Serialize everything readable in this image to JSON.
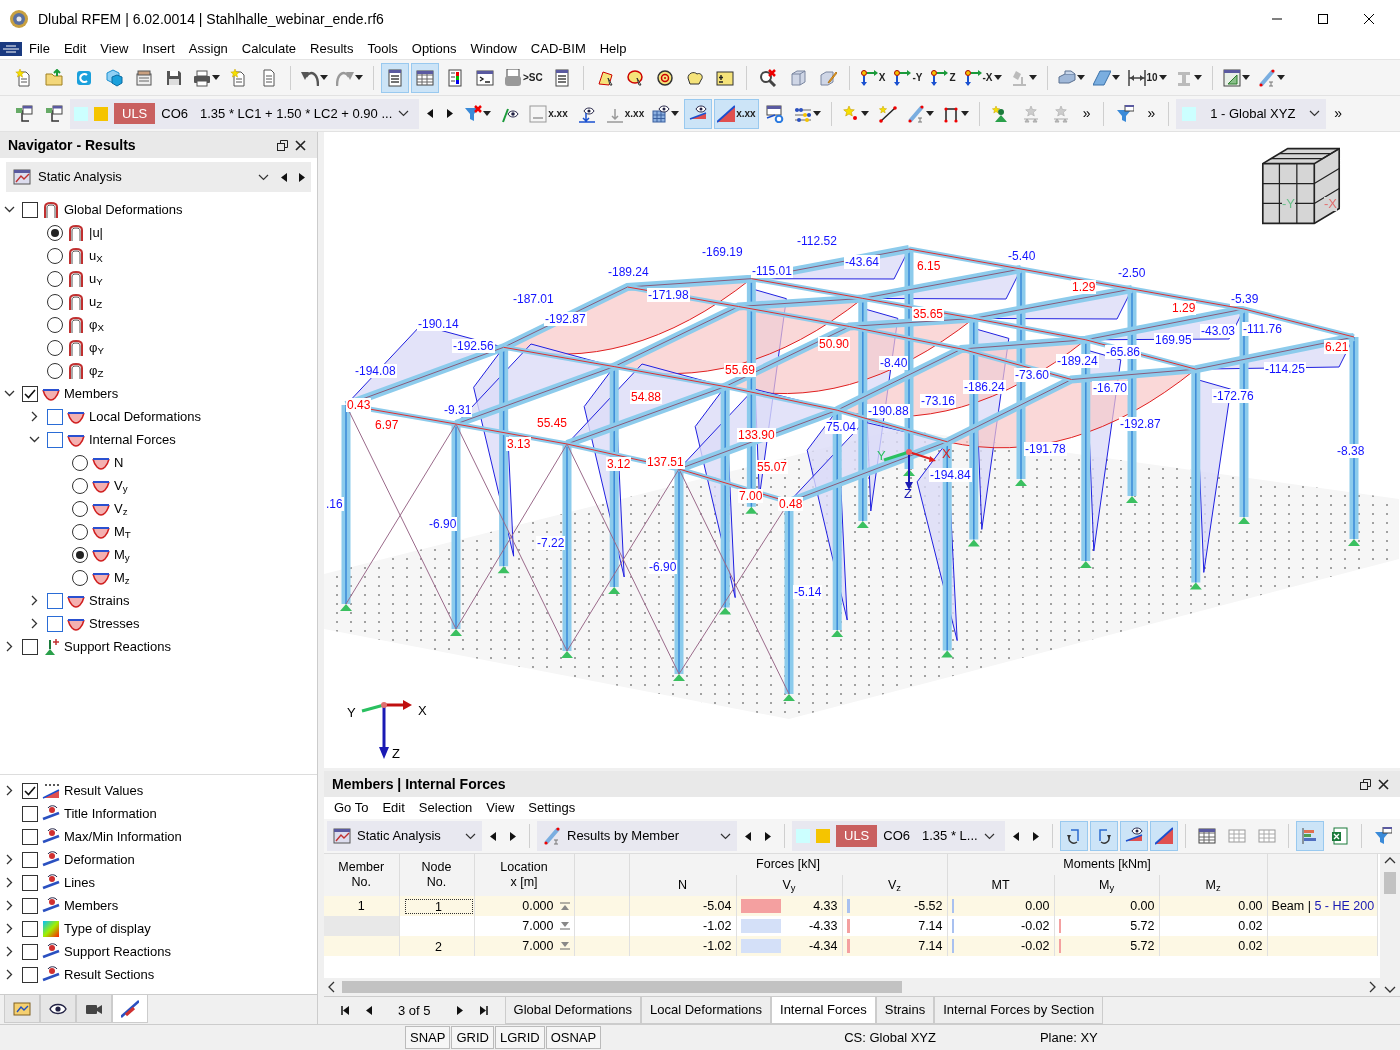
{
  "window": {
    "title": "Dlubal RFEM | 6.02.0014 | Stahlhalle_webinar_ende.rf6"
  },
  "menu": [
    "File",
    "Edit",
    "View",
    "Insert",
    "Assign",
    "Calculate",
    "Results",
    "Tools",
    "Options",
    "Window",
    "CAD-BIM",
    "Help"
  ],
  "toolbar_1": [
    {
      "kind": "button",
      "dropdown": false,
      "selected": false
    },
    {
      "kind": "button",
      "dropdown": false,
      "selected": false
    },
    {
      "kind": "button",
      "dropdown": false,
      "selected": false
    },
    {
      "kind": "button",
      "dropdown": false,
      "selected": false
    },
    {
      "kind": "button",
      "dropdown": false,
      "selected": false
    },
    {
      "kind": "button",
      "dropdown": false,
      "selected": false
    },
    {
      "kind": "button",
      "dropdown": true,
      "selected": false
    },
    {
      "kind": "button",
      "dropdown": false,
      "selected": false
    },
    {
      "kind": "button",
      "dropdown": false,
      "selected": false
    },
    {
      "kind": "separator"
    },
    {
      "kind": "button",
      "dropdown": true,
      "selected": false
    },
    {
      "kind": "button",
      "dropdown": true,
      "selected": false
    },
    {
      "kind": "separator"
    },
    {
      "kind": "button",
      "dropdown": false,
      "selected": true
    },
    {
      "kind": "button",
      "dropdown": false,
      "selected": true
    },
    {
      "kind": "button",
      "dropdown": false,
      "selected": false
    },
    {
      "kind": "button",
      "dropdown": false,
      "selected": false
    },
    {
      "kind": "button",
      "dropdown": false,
      "selected": false,
      "text": ">SC"
    },
    {
      "kind": "button",
      "dropdown": false,
      "selected": false
    },
    {
      "kind": "separator"
    },
    {
      "kind": "button",
      "dropdown": false,
      "selected": false
    },
    {
      "kind": "button",
      "dropdown": false,
      "selected": false
    },
    {
      "kind": "button",
      "dropdown": false,
      "selected": false
    },
    {
      "kind": "button",
      "dropdown": false,
      "selected": false
    },
    {
      "kind": "button",
      "dropdown": false,
      "selected": false
    },
    {
      "kind": "separator"
    },
    {
      "kind": "button",
      "dropdown": false,
      "selected": false
    },
    {
      "kind": "button",
      "dropdown": false,
      "selected": false
    },
    {
      "kind": "button",
      "dropdown": false,
      "selected": false
    },
    {
      "kind": "separator"
    },
    {
      "kind": "button",
      "dropdown": false,
      "selected": false,
      "text": "X"
    },
    {
      "kind": "button",
      "dropdown": false,
      "selected": false,
      "text": "-Y"
    },
    {
      "kind": "button",
      "dropdown": false,
      "selected": false,
      "text": "Z"
    },
    {
      "kind": "button",
      "dropdown": true,
      "selected": false,
      "text": "-X"
    },
    {
      "kind": "button",
      "dropdown": true,
      "selected": false
    },
    {
      "kind": "separator"
    },
    {
      "kind": "button",
      "dropdown": true,
      "selected": false
    },
    {
      "kind": "button",
      "dropdown": true,
      "selected": false
    },
    {
      "kind": "button",
      "dropdown": true,
      "selected": false,
      "text": "10"
    },
    {
      "kind": "button",
      "dropdown": true,
      "selected": false
    },
    {
      "kind": "separator"
    },
    {
      "kind": "button",
      "dropdown": true,
      "selected": false
    },
    {
      "kind": "button",
      "dropdown": true,
      "selected": false
    }
  ],
  "toolbar_2": [
    {
      "kind": "button",
      "dropdown": false,
      "selected": false
    },
    {
      "kind": "button",
      "dropdown": false,
      "selected": false
    },
    {
      "kind": "loadcase",
      "swatches": [
        {
          "color": "#ccffff"
        },
        {
          "color": "#f5c400"
        }
      ],
      "type": "ULS",
      "name": "CO6",
      "combo": "1.35 * LC1 + 1.50 * LC2 + 0.90 ..."
    },
    {
      "kind": "button",
      "dropdown": true,
      "selected": false
    },
    {
      "kind": "button",
      "dropdown": false,
      "selected": false
    },
    {
      "kind": "button",
      "dropdown": false,
      "selected": false,
      "text": "x.xx"
    },
    {
      "kind": "button",
      "dropdown": false,
      "selected": false
    },
    {
      "kind": "button",
      "dropdown": false,
      "selected": false,
      "text": "x.xx"
    },
    {
      "kind": "button",
      "dropdown": true,
      "selected": false
    },
    {
      "kind": "button",
      "dropdown": false,
      "selected": true
    },
    {
      "kind": "button",
      "dropdown": false,
      "selected": true,
      "text": "x.xx"
    },
    {
      "kind": "button",
      "dropdown": false,
      "selected": false
    },
    {
      "kind": "button",
      "dropdown": true,
      "selected": false
    },
    {
      "kind": "separator"
    },
    {
      "kind": "button",
      "dropdown": true,
      "selected": false
    },
    {
      "kind": "button",
      "dropdown": false,
      "selected": false
    },
    {
      "kind": "button",
      "dropdown": true,
      "selected": false
    },
    {
      "kind": "button",
      "dropdown": true,
      "selected": false
    },
    {
      "kind": "separator"
    },
    {
      "kind": "button",
      "dropdown": false,
      "selected": false
    },
    {
      "kind": "button",
      "dropdown": false,
      "selected": false
    },
    {
      "kind": "button",
      "dropdown": false,
      "selected": false
    },
    {
      "kind": "more",
      "text": "»"
    },
    {
      "kind": "separator"
    },
    {
      "kind": "button",
      "dropdown": false,
      "selected": false
    },
    {
      "kind": "more",
      "text": "»"
    },
    {
      "kind": "separator"
    },
    {
      "kind": "combo",
      "color": "#ccffff",
      "text": "1 - Global XYZ"
    },
    {
      "kind": "more",
      "text": "»"
    }
  ],
  "navigator": {
    "title": "Navigator - Results",
    "analysis": "Static Analysis",
    "tree": [
      {
        "label": "Global Deformations",
        "kind": "deformation",
        "checked": false,
        "expanded": true,
        "children": [
          {
            "label": "|u|",
            "kind": "deformation",
            "selected": true
          },
          {
            "label": "u$_{X}$",
            "kind": "deformation",
            "selected": false
          },
          {
            "label": "u$_{Y}$",
            "kind": "deformation",
            "selected": false
          },
          {
            "label": "u$_{Z}$",
            "kind": "deformation",
            "selected": false
          },
          {
            "label": "φ$_{X}$",
            "kind": "deformation",
            "selected": false
          },
          {
            "label": "φ$_{Y}$",
            "kind": "deformation",
            "selected": false
          },
          {
            "label": "φ$_{Z}$",
            "kind": "deformation",
            "selected": false
          }
        ]
      },
      {
        "label": "Members",
        "kind": "member",
        "checked": true,
        "expanded": true,
        "children": [
          {
            "label": "Local Deformations",
            "kind": "member",
            "checked": false,
            "expanded": false
          },
          {
            "label": "Internal Forces",
            "kind": "member",
            "checked": false,
            "expanded": true,
            "children": [
              {
                "label": "N",
                "kind": "member",
                "selected": false
              },
              {
                "label": "V$_{y}$",
                "kind": "member",
                "selected": false
              },
              {
                "label": "V$_{z}$",
                "kind": "member",
                "selected": false
              },
              {
                "label": "M$_{T}$",
                "kind": "member",
                "selected": false
              },
              {
                "label": "M$_{y}$",
                "kind": "member",
                "selected": true
              },
              {
                "label": "M$_{z}$",
                "kind": "member",
                "selected": false
              }
            ]
          },
          {
            "label": "Strains",
            "kind": "member",
            "checked": false,
            "expanded": false
          },
          {
            "label": "Stresses",
            "kind": "member",
            "checked": false,
            "expanded": false
          }
        ]
      },
      {
        "label": "Support Reactions",
        "kind": "support",
        "checked": false,
        "expanded": false
      }
    ],
    "display_tree": [
      {
        "label": "Result Values",
        "kind": "values",
        "checked": true,
        "expanded": false
      },
      {
        "label": "Title Information",
        "kind": "display",
        "checked": false
      },
      {
        "label": "Max/Min Information",
        "kind": "display",
        "checked": false
      },
      {
        "label": "Deformation",
        "kind": "display",
        "checked": false,
        "expanded": false
      },
      {
        "label": "Lines",
        "kind": "display",
        "checked": false,
        "expanded": false
      },
      {
        "label": "Members",
        "kind": "display",
        "checked": false,
        "expanded": false
      },
      {
        "label": "Type of display",
        "kind": "gradient",
        "checked": false,
        "expanded": false
      },
      {
        "label": "Support Reactions",
        "kind": "display",
        "checked": false,
        "expanded": false
      },
      {
        "label": "Result Sections",
        "kind": "display",
        "checked": false,
        "expanded": false
      }
    ],
    "tabs": [
      {
        "selected": false
      },
      {
        "selected": false
      },
      {
        "selected": false
      },
      {
        "selected": true
      }
    ]
  },
  "model_view": {
    "labels": [
      {
        "text": "-112.52",
        "color": "#1414ff"
      },
      {
        "text": "-169.19",
        "color": "#1414ff"
      },
      {
        "text": "-5.40",
        "color": "#1414ff"
      },
      {
        "text": "-43.64",
        "color": "#1414ff"
      },
      {
        "text": "6.15",
        "color": "#ff0000"
      },
      {
        "text": "-189.24",
        "color": "#1414ff"
      },
      {
        "text": "-115.01",
        "color": "#1414ff"
      },
      {
        "text": "-2.50",
        "color": "#1414ff"
      },
      {
        "text": "1.29",
        "color": "#ff0000"
      },
      {
        "text": "-187.01",
        "color": "#1414ff"
      },
      {
        "text": "-171.98",
        "color": "#1414ff"
      },
      {
        "text": "-5.39",
        "color": "#1414ff"
      },
      {
        "text": "1.29",
        "color": "#ff0000"
      },
      {
        "text": "35.65",
        "color": "#ff0000"
      },
      {
        "text": "-190.14",
        "color": "#1414ff"
      },
      {
        "text": "-192.87",
        "color": "#1414ff"
      },
      {
        "text": "-43.03",
        "color": "#1414ff"
      },
      {
        "text": "-111.76",
        "color": "#1414ff"
      },
      {
        "text": "169.95",
        "color": "#1414ff"
      },
      {
        "text": "-192.56",
        "color": "#1414ff"
      },
      {
        "text": "50.90",
        "color": "#ff0000"
      },
      {
        "text": "6.21",
        "color": "#ff0000"
      },
      {
        "text": "-65.86",
        "color": "#1414ff"
      },
      {
        "text": "-8.40",
        "color": "#1414ff"
      },
      {
        "text": "-189.24",
        "color": "#1414ff"
      },
      {
        "text": "-194.08",
        "color": "#1414ff"
      },
      {
        "text": "55.69",
        "color": "#ff0000"
      },
      {
        "text": "-114.25",
        "color": "#1414ff"
      },
      {
        "text": "-73.60",
        "color": "#1414ff"
      },
      {
        "text": "-186.24",
        "color": "#1414ff"
      },
      {
        "text": "-16.70",
        "color": "#1414ff"
      },
      {
        "text": "54.88",
        "color": "#ff0000"
      },
      {
        "text": "-172.76",
        "color": "#1414ff"
      },
      {
        "text": "0.43",
        "color": "#ff0000"
      },
      {
        "text": "-73.16",
        "color": "#1414ff"
      },
      {
        "text": "-9.31",
        "color": "#1414ff"
      },
      {
        "text": "-190.88",
        "color": "#1414ff"
      },
      {
        "text": "6.97",
        "color": "#ff0000"
      },
      {
        "text": "55.45",
        "color": "#ff0000"
      },
      {
        "text": "75.04",
        "color": "#1414ff"
      },
      {
        "text": "-192.87",
        "color": "#1414ff"
      },
      {
        "text": "133.90",
        "color": "#ff0000"
      },
      {
        "text": "3.13",
        "color": "#ff0000"
      },
      {
        "text": "-191.78",
        "color": "#1414ff"
      },
      {
        "text": "-8.38",
        "color": "#1414ff"
      },
      {
        "text": "3.12",
        "color": "#ff0000"
      },
      {
        "text": "137.51",
        "color": "#ff0000"
      },
      {
        "text": "55.07",
        "color": "#ff0000"
      },
      {
        "text": "-194.84",
        "color": "#1414ff"
      },
      {
        "text": "7.00",
        "color": "#ff0000"
      },
      {
        "text": ".16",
        "color": "#1414ff"
      },
      {
        "text": "0.48",
        "color": "#ff0000"
      },
      {
        "text": "-6.90",
        "color": "#1414ff"
      },
      {
        "text": "-7.22",
        "color": "#1414ff"
      },
      {
        "text": "-6.90",
        "color": "#1414ff"
      },
      {
        "text": "-5.14",
        "color": "#1414ff"
      }
    ],
    "local_axes": [
      "Y",
      "X",
      "Z"
    ],
    "global_axes": [
      "Y",
      "X",
      "Z"
    ],
    "cube_labels": [
      "-Y",
      "-X"
    ]
  },
  "results_panel": {
    "title": "Members | Internal Forces",
    "menu": [
      "Go To",
      "Edit",
      "Selection",
      "View",
      "Settings"
    ],
    "analysis": "Static Analysis",
    "result_type": "Results by Member",
    "loadcase": {
      "swatches": [
        {
          "color": "#ccffff"
        },
        {
          "color": "#f5c400"
        }
      ],
      "type": "ULS",
      "name": "CO6",
      "combo": "1.35 * L..."
    },
    "toolbar": [
      {
        "selected": true
      },
      {
        "selected": true
      },
      {
        "selected": true
      },
      {
        "selected": true
      },
      {
        "selected": false
      },
      {
        "selected": false
      },
      {
        "selected": false
      },
      {
        "selected": true
      },
      {
        "selected": false
      },
      {
        "selected": false
      }
    ],
    "table": {
      "headers": {
        "member": "Member\nNo.",
        "node": "Node\nNo.",
        "location": "Location\nx [m]",
        "forces": "Forces [kN]",
        "moments": "Moments [kNm]",
        "n": "N",
        "vy": "V$_{y}$",
        "vz": "V$_{z}$",
        "mt": "MT",
        "my": "M$_{y}$",
        "mz": "M$_{z}$"
      },
      "rows": [
        {
          "highlighted": true,
          "focused": true,
          "member": "1",
          "node": "1",
          "location": "0.000",
          "kind": "start",
          "n": "-5.04",
          "vy": {
            "text": "4.33",
            "level": 0.4,
            "color": "#f4a0a0"
          },
          "vz": {
            "text": "-5.52",
            "level": 0.03,
            "color": "#a9c1f0"
          },
          "mt": {
            "text": "0.00",
            "level": 0.02,
            "color": "#a9c1f0"
          },
          "my": {
            "text": "0.00"
          },
          "mz": "0.00",
          "member_type": "Beam |",
          "section": "5 - HE 200"
        },
        {
          "highlighted": false,
          "focused": false,
          "member": "",
          "node": "",
          "location": "7.000",
          "kind": "end",
          "n": "-1.02",
          "vy": {
            "text": "-4.33",
            "level": 0.4,
            "color": "#d4e0f8"
          },
          "vz": {
            "text": "7.14",
            "level": 0.03,
            "color": "#f4a0a0"
          },
          "mt": {
            "text": "-0.02",
            "level": 0.02,
            "color": "#a9c1f0"
          },
          "my": {
            "text": "5.72",
            "level": 0.02,
            "color": "#f4a0a0"
          },
          "mz": "0.02"
        },
        {
          "highlighted": true,
          "focused": false,
          "member": "",
          "node": "2",
          "location": "7.000",
          "kind": "end",
          "n": "-1.02",
          "vy": {
            "text": "-4.34",
            "level": 0.4,
            "color": "#d4e0f8"
          },
          "vz": {
            "text": "7.14",
            "level": 0.03,
            "color": "#f4a0a0"
          },
          "mt": {
            "text": "-0.02",
            "level": 0.02,
            "color": "#a9c1f0"
          },
          "my": {
            "text": "5.72",
            "level": 0.02,
            "color": "#f4a0a0"
          },
          "mz": "0.02"
        }
      ]
    },
    "pager": "3 of 5",
    "tabs": [
      {
        "label": "Global Deformations",
        "selected": false
      },
      {
        "label": "Local Deformations",
        "selected": false
      },
      {
        "label": "Internal Forces",
        "selected": true
      },
      {
        "label": "Strains",
        "selected": false
      },
      {
        "label": "Internal Forces by Section",
        "selected": false
      }
    ]
  },
  "status_bar": {
    "toggles": [
      "SNAP",
      "GRID",
      "LGRID",
      "OSNAP"
    ],
    "cs": "CS: Global XYZ",
    "plane": "Plane: XY"
  }
}
